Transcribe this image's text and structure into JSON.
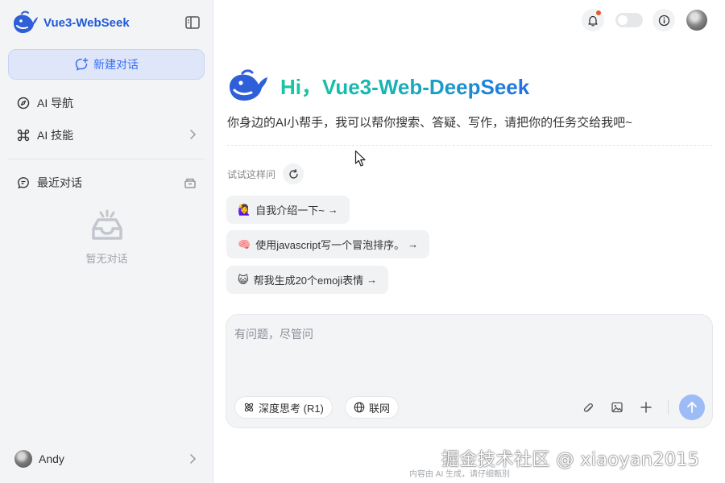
{
  "app": {
    "brand_name": "Vue3-WebSeek"
  },
  "sidebar": {
    "new_chat_label": "新建对话",
    "nav": [
      {
        "label": "AI 导航",
        "icon": "compass-icon"
      },
      {
        "label": "AI 技能",
        "icon": "command-icon"
      }
    ],
    "recent_label": "最近对话",
    "empty_label": "暂无对话",
    "user_name": "Andy"
  },
  "hero": {
    "title": "Hi，Vue3-Web-DeepSeek",
    "subtitle": "你身边的AI小帮手，我可以帮你搜索、答疑、写作，请把你的任务交给我吧~"
  },
  "suggestions": {
    "label": "试试这样问",
    "items": [
      {
        "emoji": "🙋‍♀️",
        "text": "自我介绍一下~",
        "arrow": "→"
      },
      {
        "emoji": "🧠",
        "text": "使用javascript写一个冒泡排序。",
        "arrow": "→"
      },
      {
        "emoji": "😺",
        "text": "帮我生成20个emoji表情",
        "arrow": "→"
      }
    ]
  },
  "composer": {
    "placeholder": "有问题，尽管问",
    "deep_think_label": "深度思考 (R1)",
    "web_label": "联网"
  },
  "footer": {
    "note": "内容由 AI 生成，请仔细甄别",
    "watermark": "掘金技术社区 @ xiaoyan2015"
  },
  "colors": {
    "accent": "#3b6ef5",
    "brand": "#1e5bd6",
    "send_button": "#9dbcf6",
    "notification_dot": "#e8552f"
  }
}
